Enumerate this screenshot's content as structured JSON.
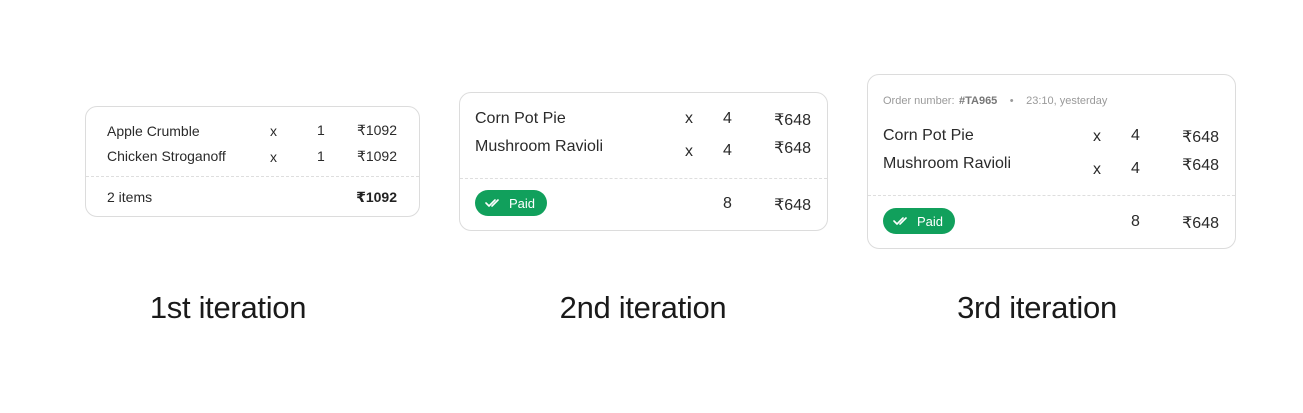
{
  "iterations": [
    {
      "caption": "1st iteration",
      "rows": [
        {
          "name": "Apple Crumble",
          "x": "x",
          "qty": "1",
          "price": "₹1092"
        },
        {
          "name": "Chicken Stroganoff",
          "x": "x",
          "qty": "1",
          "price": "₹1092"
        }
      ],
      "footer": {
        "items_label": "2 items",
        "total": "₹1092"
      }
    },
    {
      "caption": "2nd iteration",
      "rows": [
        {
          "name": "Corn Pot Pie",
          "x": "x",
          "qty": "4",
          "price": "₹648"
        },
        {
          "name": "Mushroom Ravioli",
          "x": "x",
          "qty": "4",
          "price": "₹648"
        }
      ],
      "footer": {
        "status": "Paid",
        "qty": "8",
        "total": "₹648"
      }
    },
    {
      "caption": "3rd iteration",
      "order": {
        "label": "Order number:",
        "number": "#TA965",
        "separator": "•",
        "time": "23:10, yesterday"
      },
      "rows": [
        {
          "name": "Corn Pot Pie",
          "x": "x",
          "qty": "4",
          "price": "₹648"
        },
        {
          "name": "Mushroom Ravioli",
          "x": "x",
          "qty": "4",
          "price": "₹648"
        }
      ],
      "footer": {
        "status": "Paid",
        "qty": "8",
        "total": "₹648"
      }
    }
  ],
  "colors": {
    "paid_badge": "#11a05c",
    "card_border": "#dcdcdc"
  },
  "icons": {
    "paid": "double-check-icon"
  }
}
